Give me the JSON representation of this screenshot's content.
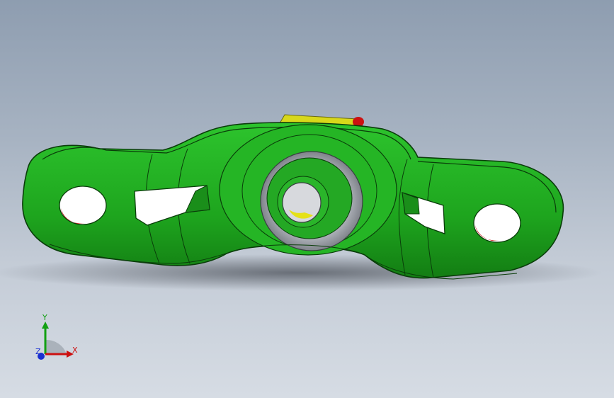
{
  "viewport": {
    "background_top": "#8e9db0",
    "background_bottom": "#d6dce4"
  },
  "model": {
    "part": "pillow-block-bearing",
    "colors": {
      "housing": "#1fae1f",
      "housing_dark": "#127a12",
      "edge": "#0a3d0a",
      "insert": "#b9bdc3",
      "grease_fitting": "#d8d81a",
      "cap_red": "#cc1111",
      "hole_accent": "#cc1111"
    }
  },
  "triad": {
    "x_label": "X",
    "y_label": "Y",
    "z_label": "Z",
    "x_color": "#cc1010",
    "y_color": "#12a012",
    "z_color": "#1a2fd0"
  }
}
